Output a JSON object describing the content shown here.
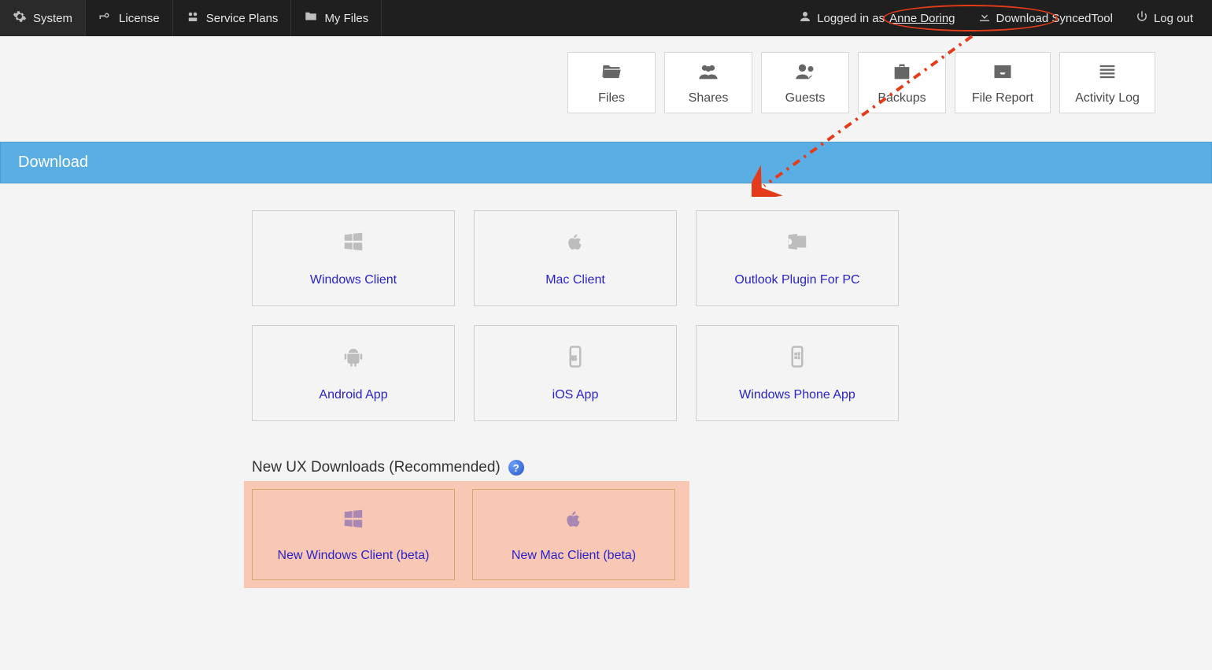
{
  "topnav": {
    "left": [
      {
        "label": "System",
        "icon": "gear-icon"
      },
      {
        "label": "License",
        "icon": "key-icon"
      },
      {
        "label": "Service Plans",
        "icon": "plans-icon"
      },
      {
        "label": "My Files",
        "icon": "folder-icon"
      }
    ],
    "logged_in_prefix": "Logged in as ",
    "user_name": "Anne Doring",
    "download_label": "Download SyncedTool",
    "logout_label": "Log out"
  },
  "tiles": [
    {
      "label": "Files",
      "icon": "folder-open-icon"
    },
    {
      "label": "Shares",
      "icon": "group-icon"
    },
    {
      "label": "Guests",
      "icon": "guests-icon"
    },
    {
      "label": "Backups",
      "icon": "briefcase-icon"
    },
    {
      "label": "File Report",
      "icon": "inbox-icon"
    },
    {
      "label": "Activity Log",
      "icon": "list-icon"
    }
  ],
  "download_heading": "Download",
  "download_grid": [
    {
      "label": "Windows Client",
      "icon": "windows-icon"
    },
    {
      "label": "Mac Client",
      "icon": "apple-icon"
    },
    {
      "label": "Outlook Plugin For PC",
      "icon": "outlook-icon"
    },
    {
      "label": "Android App",
      "icon": "android-icon"
    },
    {
      "label": "iOS App",
      "icon": "ios-phone-icon"
    },
    {
      "label": "Windows Phone App",
      "icon": "windows-phone-icon"
    }
  ],
  "newux_heading": "New UX Downloads (Recommended)",
  "newux_cards": [
    {
      "label": "New Windows Client (beta)",
      "icon": "windows-icon"
    },
    {
      "label": "New Mac Client (beta)",
      "icon": "apple-icon"
    }
  ],
  "annotation": {
    "ellipse_target": "download-syncedtool-link",
    "arrow_points_to": "download-heading"
  }
}
